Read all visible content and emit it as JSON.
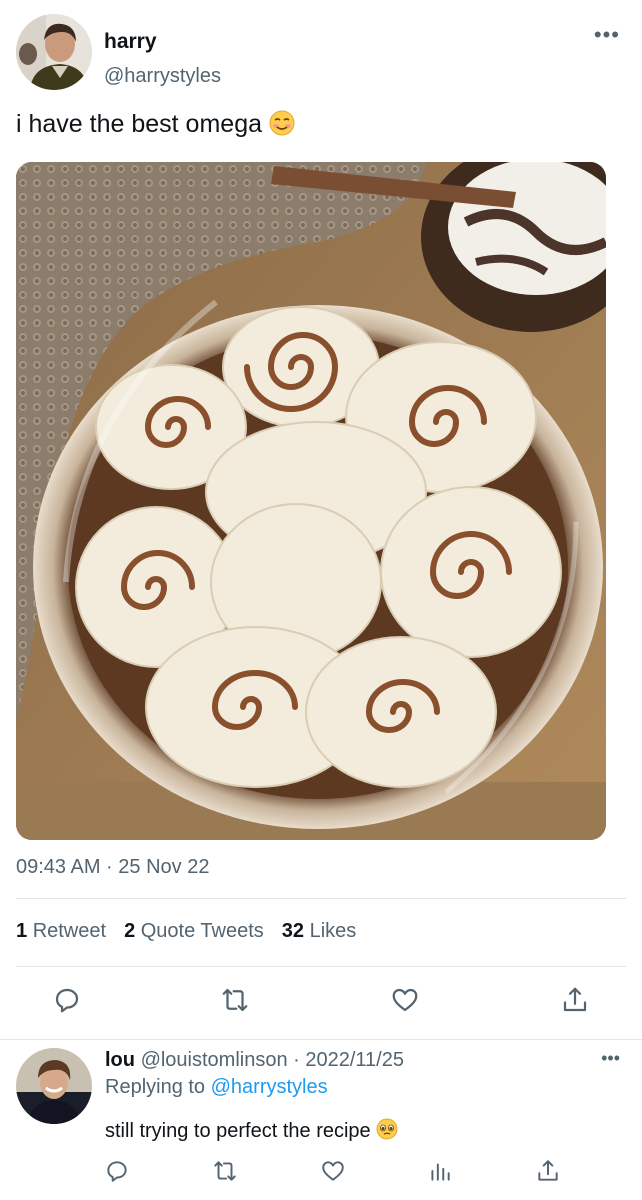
{
  "tweet": {
    "author_name": "harry",
    "author_handle": "@harrystyles",
    "more_icon": "more-horizontal-icon",
    "text": "i have the best omega",
    "emoji": "smiling-face-emoji",
    "timestamp": "09:43 AM · 25 Nov 22",
    "stats": {
      "retweets_count": "1",
      "retweets_label": "Retweet",
      "quotes_count": "2",
      "quotes_label": "Quote Tweets",
      "likes_count": "32",
      "likes_label": "Likes"
    },
    "actions": [
      "reply-icon",
      "retweet-icon",
      "like-icon",
      "share-icon"
    ]
  },
  "reply": {
    "author_name": "lou",
    "author_handle": "@louistomlinson",
    "date": "· 2022/11/25",
    "replying_label": "Replying to",
    "replying_to": "@harrystyles",
    "text": "still trying to perfect the recipe",
    "emoji": "pleading-face-emoji",
    "actions": [
      "reply-icon",
      "retweet-icon",
      "like-icon",
      "analytics-icon",
      "share-icon"
    ]
  },
  "colors": {
    "primary_text": "#0f1419",
    "secondary_text": "#536471",
    "link": "#1d9bf0",
    "divider": "#e3e6e9"
  }
}
